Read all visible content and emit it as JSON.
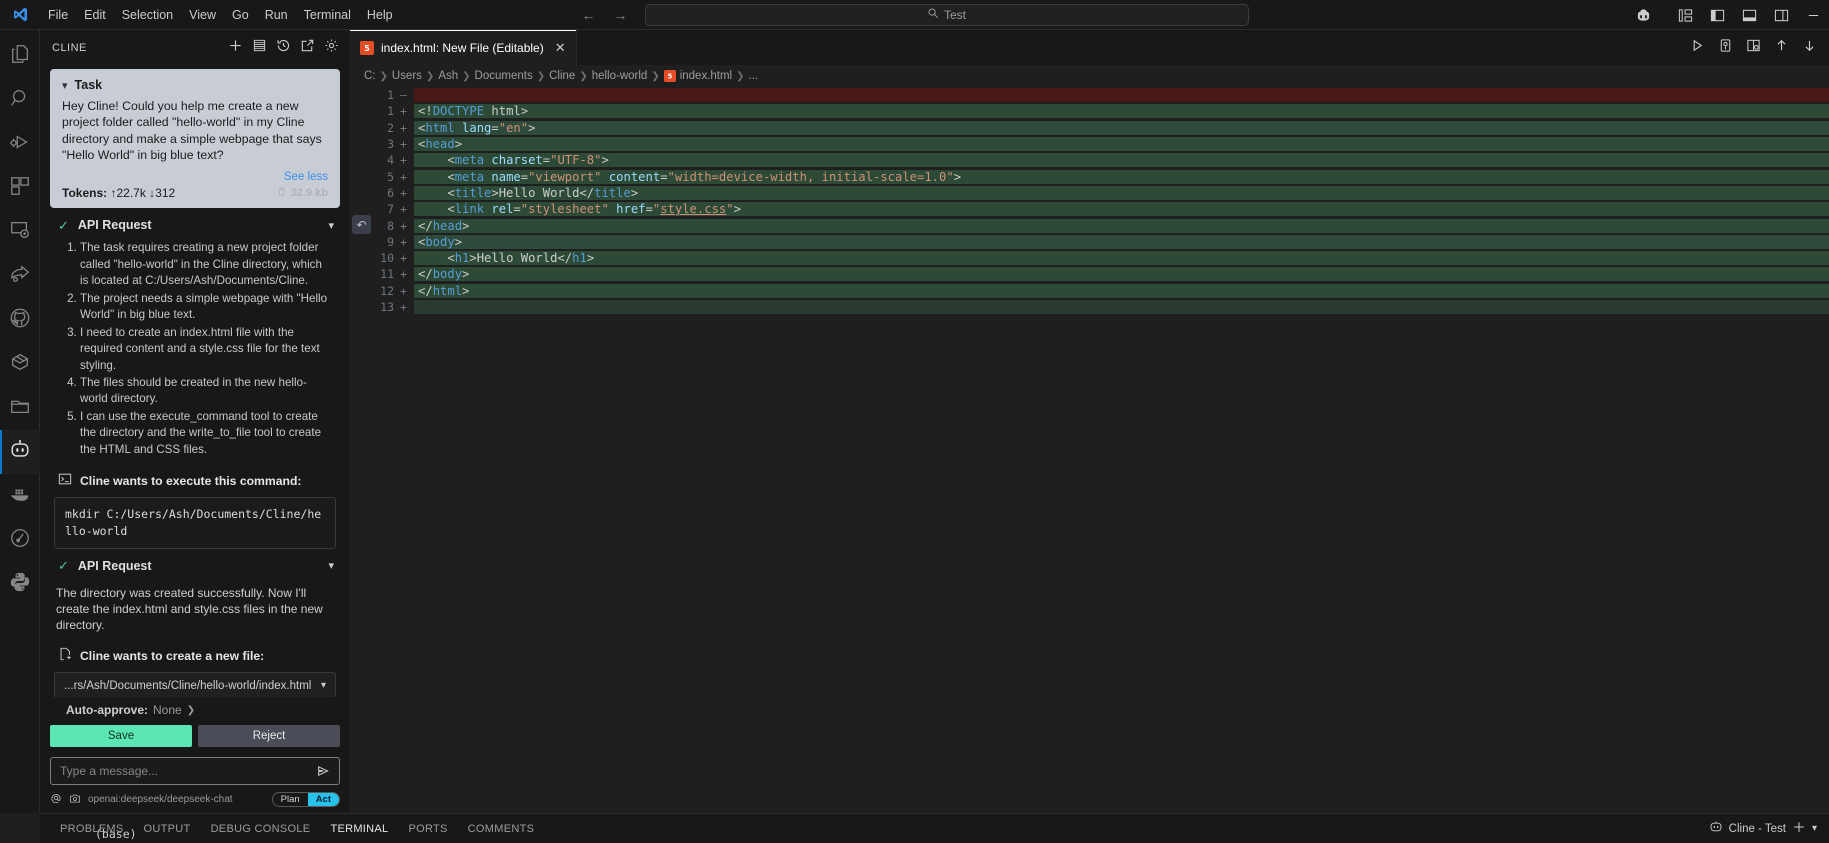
{
  "titlebar": {
    "menus": [
      "File",
      "Edit",
      "Selection",
      "View",
      "Go",
      "Run",
      "Terminal",
      "Help"
    ],
    "command_center_value": "Test",
    "search_icon": "search-icon",
    "back_icon": "arrow-left-icon",
    "forward_icon": "arrow-right-icon",
    "right_icons": [
      "copilot-icon",
      "layout-panel-icon",
      "toggle-primary-sidebar-icon",
      "toggle-panel-icon",
      "toggle-secondary-sidebar-icon",
      "minimize-icon"
    ]
  },
  "activitybar": {
    "items": [
      {
        "name": "explorer",
        "icon": "files-icon"
      },
      {
        "name": "search",
        "icon": "search-icon"
      },
      {
        "name": "run-and-debug",
        "icon": "run-debug-icon"
      },
      {
        "name": "extensions",
        "icon": "extensions-icon"
      },
      {
        "name": "remote-explorer",
        "icon": "remote-icon"
      },
      {
        "name": "share",
        "icon": "share-icon"
      },
      {
        "name": "github",
        "icon": "github-icon"
      },
      {
        "name": "continue",
        "icon": "continue-icon"
      },
      {
        "name": "project-manager",
        "icon": "folder-icon"
      },
      {
        "name": "cline",
        "icon": "cline-robot-icon",
        "active": true
      },
      {
        "name": "docker",
        "icon": "docker-whale-icon"
      },
      {
        "name": "clock",
        "icon": "clock-icon"
      },
      {
        "name": "python",
        "icon": "python-icon"
      }
    ]
  },
  "sidebar": {
    "title": "CLINE",
    "header_actions": [
      {
        "name": "new-task-button",
        "icon": "plus-icon"
      },
      {
        "name": "mcp-servers-button",
        "icon": "server-icon"
      },
      {
        "name": "history-button",
        "icon": "history-icon"
      },
      {
        "name": "open-in-editor-button",
        "icon": "popout-icon"
      },
      {
        "name": "settings-button",
        "icon": "gear-icon"
      }
    ],
    "task": {
      "label": "Task",
      "text": "Hey Cline! Could you help me create a new project folder called \"hello-world\" in my Cline directory and make a simple webpage that says \"Hello World\" in big blue text?",
      "see_less": "See less",
      "tokens_label": "Tokens:",
      "tokens_up": "22.7k",
      "tokens_down": "312",
      "size": "32.9 kb"
    },
    "api_request_1": {
      "label": "API Request",
      "reasoning": [
        "The task requires creating a new project folder called \"hello-world\" in the Cline directory, which is located at C:/Users/Ash/Documents/Cline.",
        "The project needs a simple webpage with \"Hello World\" in big blue text.",
        "I need to create an index.html file with the required content and a style.css file for the text styling.",
        "The files should be created in the new hello-world directory.",
        "I can use the execute_command tool to create the directory and the write_to_file tool to create the HTML and CSS files."
      ],
      "tool_prompt": "Cline wants to execute this command:",
      "command": "mkdir C:/Users/Ash/Documents/Cline/hello-world"
    },
    "api_request_2": {
      "label": "API Request",
      "paragraph": "The directory was created successfully. Now I'll create the index.html and style.css files in the new directory.",
      "tool_prompt": "Cline wants to create a new file:",
      "file_path": "...rs/Ash/Documents/Cline/hello-world/index.html"
    },
    "footer": {
      "auto_approve_label": "Auto-approve:",
      "auto_approve_value": "None",
      "save_button": "Save",
      "reject_button": "Reject",
      "message_placeholder": "Type a message...",
      "message_value": "",
      "model_name": "openai:deepseek/deepseek-chat",
      "mode_plan": "Plan",
      "mode_act": "Act"
    }
  },
  "editor": {
    "tab": {
      "label": "index.html: New File (Editable)",
      "icon": "html5-file-icon",
      "close_icon": "close-icon"
    },
    "tab_actions": [
      {
        "name": "run-button",
        "icon": "play-icon"
      },
      {
        "name": "run-and-debug-button",
        "icon": "debug-alt-icon"
      },
      {
        "name": "split-editor-button",
        "icon": "split-editor-icon"
      },
      {
        "name": "previous-change-button",
        "icon": "arrow-up-icon"
      },
      {
        "name": "next-change-button",
        "icon": "arrow-down-icon"
      }
    ],
    "breadcrumb": [
      "C:",
      "Users",
      "Ash",
      "Documents",
      "Cline",
      "hello-world",
      "index.html",
      "..."
    ],
    "fold_widget_icon": "undo-revert-icon",
    "lines": [
      {
        "num": "1",
        "mark": "—",
        "kind": "removed",
        "tokens": []
      },
      {
        "num": "1",
        "mark": "+",
        "kind": "added",
        "tokens": [
          {
            "t": "<!",
            "c": "punct"
          },
          {
            "t": "DOCTYPE",
            "c": "tag"
          },
          {
            "t": " html>",
            "c": "punct"
          }
        ]
      },
      {
        "num": "2",
        "mark": "+",
        "kind": "added-alt",
        "tokens": [
          {
            "t": "<",
            "c": "punct"
          },
          {
            "t": "html",
            "c": "tag"
          },
          {
            "t": " ",
            "c": "punct"
          },
          {
            "t": "lang",
            "c": "attr"
          },
          {
            "t": "=",
            "c": "punct"
          },
          {
            "t": "\"en\"",
            "c": "str"
          },
          {
            "t": ">",
            "c": "punct"
          }
        ]
      },
      {
        "num": "3",
        "mark": "+",
        "kind": "added",
        "tokens": [
          {
            "t": "<",
            "c": "punct"
          },
          {
            "t": "head",
            "c": "tag"
          },
          {
            "t": ">",
            "c": "punct"
          }
        ]
      },
      {
        "num": "4",
        "mark": "+",
        "kind": "added",
        "tokens": [
          {
            "t": "    <",
            "c": "punct"
          },
          {
            "t": "meta",
            "c": "tag"
          },
          {
            "t": " ",
            "c": "punct"
          },
          {
            "t": "charset",
            "c": "attr"
          },
          {
            "t": "=",
            "c": "punct"
          },
          {
            "t": "\"UTF-8\"",
            "c": "str"
          },
          {
            "t": ">",
            "c": "punct"
          }
        ]
      },
      {
        "num": "5",
        "mark": "+",
        "kind": "added",
        "tokens": [
          {
            "t": "    <",
            "c": "punct"
          },
          {
            "t": "meta",
            "c": "tag"
          },
          {
            "t": " ",
            "c": "punct"
          },
          {
            "t": "name",
            "c": "attr"
          },
          {
            "t": "=",
            "c": "punct"
          },
          {
            "t": "\"viewport\"",
            "c": "str"
          },
          {
            "t": " ",
            "c": "punct"
          },
          {
            "t": "content",
            "c": "attr"
          },
          {
            "t": "=",
            "c": "punct"
          },
          {
            "t": "\"width=device-width, initial-scale=1.0\"",
            "c": "str"
          },
          {
            "t": ">",
            "c": "punct"
          }
        ]
      },
      {
        "num": "6",
        "mark": "+",
        "kind": "added",
        "tokens": [
          {
            "t": "    <",
            "c": "punct"
          },
          {
            "t": "title",
            "c": "tag"
          },
          {
            "t": ">",
            "c": "punct"
          },
          {
            "t": "Hello World",
            "c": "txt"
          },
          {
            "t": "</",
            "c": "punct"
          },
          {
            "t": "title",
            "c": "tag"
          },
          {
            "t": ">",
            "c": "punct"
          }
        ]
      },
      {
        "num": "7",
        "mark": "+",
        "kind": "added",
        "tokens": [
          {
            "t": "    <",
            "c": "punct"
          },
          {
            "t": "link",
            "c": "tag"
          },
          {
            "t": " ",
            "c": "punct"
          },
          {
            "t": "rel",
            "c": "attr"
          },
          {
            "t": "=",
            "c": "punct"
          },
          {
            "t": "\"stylesheet\"",
            "c": "str"
          },
          {
            "t": " ",
            "c": "punct"
          },
          {
            "t": "href",
            "c": "attr"
          },
          {
            "t": "=",
            "c": "punct"
          },
          {
            "t": "\"",
            "c": "str"
          },
          {
            "t": "style.css",
            "c": "link"
          },
          {
            "t": "\"",
            "c": "str"
          },
          {
            "t": ">",
            "c": "punct"
          }
        ]
      },
      {
        "num": "8",
        "mark": "+",
        "kind": "added",
        "tokens": [
          {
            "t": "</",
            "c": "punct"
          },
          {
            "t": "head",
            "c": "tag"
          },
          {
            "t": ">",
            "c": "punct"
          }
        ]
      },
      {
        "num": "9",
        "mark": "+",
        "kind": "added-alt",
        "tokens": [
          {
            "t": "<",
            "c": "punct"
          },
          {
            "t": "body",
            "c": "tag"
          },
          {
            "t": ">",
            "c": "punct"
          }
        ]
      },
      {
        "num": "10",
        "mark": "+",
        "kind": "added",
        "tokens": [
          {
            "t": "    <",
            "c": "punct"
          },
          {
            "t": "h1",
            "c": "tag"
          },
          {
            "t": ">",
            "c": "punct"
          },
          {
            "t": "Hello World",
            "c": "txt"
          },
          {
            "t": "</",
            "c": "punct"
          },
          {
            "t": "h1",
            "c": "tag"
          },
          {
            "t": ">",
            "c": "punct"
          }
        ]
      },
      {
        "num": "11",
        "mark": "+",
        "kind": "added",
        "tokens": [
          {
            "t": "</",
            "c": "punct"
          },
          {
            "t": "body",
            "c": "tag"
          },
          {
            "t": ">",
            "c": "punct"
          }
        ]
      },
      {
        "num": "12",
        "mark": "+",
        "kind": "added",
        "tokens": [
          {
            "t": "</",
            "c": "punct"
          },
          {
            "t": "html",
            "c": "tag"
          },
          {
            "t": ">",
            "c": "punct"
          }
        ]
      },
      {
        "num": "13",
        "mark": "+",
        "kind": "empty-added",
        "tokens": []
      }
    ]
  },
  "panel": {
    "tabs": [
      "PROBLEMS",
      "OUTPUT",
      "DEBUG CONSOLE",
      "TERMINAL",
      "PORTS",
      "COMMENTS"
    ],
    "active_tab": "TERMINAL",
    "terminal_name": "Cline - Test",
    "terminal_icon": "cline-robot-icon",
    "new_terminal_icon": "plus-icon",
    "terminal_dropdown_icon": "chevron-down-icon",
    "terminal_output": "(base)"
  }
}
